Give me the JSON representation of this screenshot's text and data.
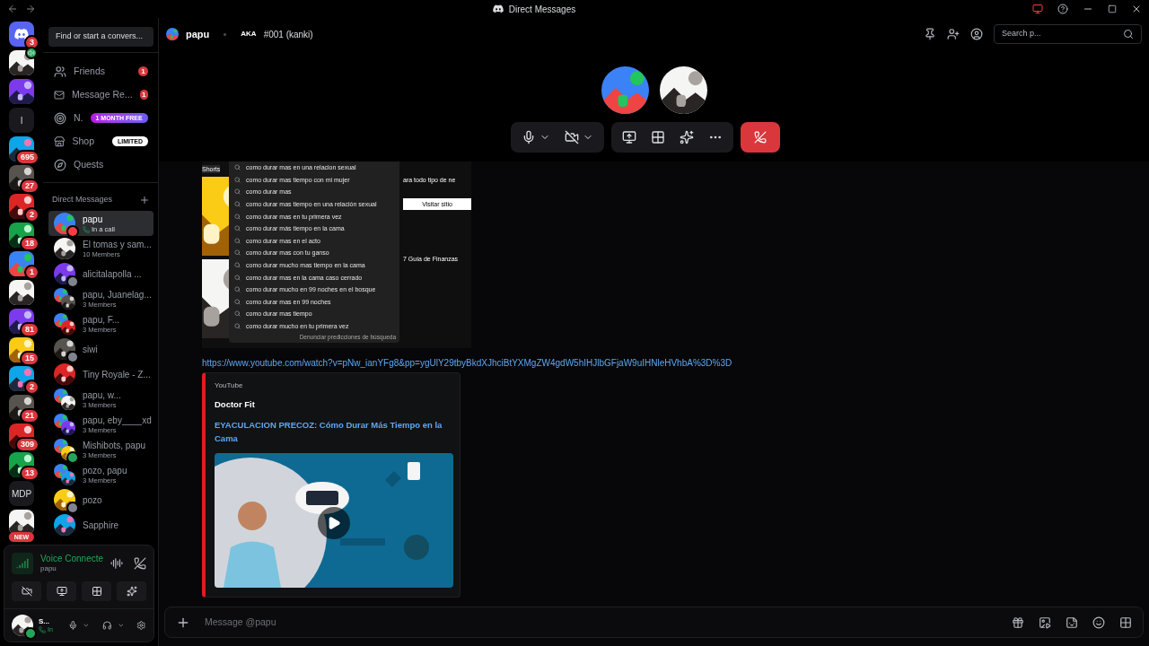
{
  "window": {
    "title": "Direct Messages"
  },
  "servers": [
    {
      "kind": "home",
      "badge": "3"
    },
    {
      "kind": "picture",
      "voice": true
    },
    {
      "kind": "picture"
    },
    {
      "kind": "text",
      "label": "l"
    },
    {
      "kind": "picture",
      "badge": "695"
    },
    {
      "kind": "picture",
      "badge": "27"
    },
    {
      "kind": "picture",
      "badge": "2"
    },
    {
      "kind": "picture",
      "badge": "18"
    },
    {
      "kind": "picture",
      "badge": "1"
    },
    {
      "kind": "picture"
    },
    {
      "kind": "picture",
      "badge": "81"
    },
    {
      "kind": "picture",
      "badge": "15"
    },
    {
      "kind": "picture",
      "badge": "2"
    },
    {
      "kind": "picture",
      "badge": "21"
    },
    {
      "kind": "picture",
      "badge": "309"
    },
    {
      "kind": "picture",
      "badge": "13"
    },
    {
      "kind": "text",
      "label": "MDP"
    },
    {
      "kind": "picture",
      "tag": "NEW"
    }
  ],
  "search": {
    "label": "Find or start a convers..."
  },
  "nav": [
    {
      "kind": "friends",
      "label": "Friends",
      "badge": "1"
    },
    {
      "kind": "requests",
      "label": "Message Re...",
      "badge": "1"
    },
    {
      "kind": "nitro",
      "label": "N.",
      "promo": "1 MONTH FREE"
    },
    {
      "kind": "shop",
      "label": "Shop",
      "tag": "LIMITED"
    },
    {
      "kind": "quests",
      "label": "Quests"
    }
  ],
  "dm_header": {
    "label": "Direct Messages"
  },
  "dms": [
    {
      "name": "papu",
      "subtitle": "In a call",
      "in_call": true,
      "group": false,
      "color": "#f23f43",
      "selected": true
    },
    {
      "name": "El tomas y sam...",
      "subtitle": "10 Members",
      "group": false,
      "selected": false
    },
    {
      "name": "alicitalapolla ...",
      "group": false,
      "color": "#80848e",
      "selected": false
    },
    {
      "name": "papu, Juanelag...",
      "subtitle": "3 Members",
      "group": true,
      "selected": false
    },
    {
      "name": "papu, F...",
      "subtitle": "3 Members",
      "group": true,
      "selected": false
    },
    {
      "name": "siwi",
      "group": false,
      "color": "#80848e",
      "selected": false
    },
    {
      "name": "Tiny Royale - Z...",
      "group": false,
      "selected": false
    },
    {
      "name": "papu, w...",
      "subtitle": "3 Members",
      "group": true,
      "selected": false
    },
    {
      "name": "papu, eby____xd",
      "subtitle": "3 Members",
      "group": true,
      "selected": false
    },
    {
      "name": "Mishibots, papu",
      "subtitle": "3 Members",
      "group": true,
      "color": "#23a55a",
      "selected": false
    },
    {
      "name": "pozo, papu",
      "subtitle": "3 Members",
      "group": true,
      "selected": false
    },
    {
      "name": "pozo",
      "group": false,
      "color": "#80848e",
      "selected": false
    },
    {
      "name": "Sapphire",
      "group": false,
      "selected": false
    }
  ],
  "voice": {
    "status": "Voice Connecte",
    "channel": "papu"
  },
  "user": {
    "name": "S...",
    "activity": "In",
    "color": "#23a55a"
  },
  "header": {
    "name": "papu",
    "aka": "AKA",
    "tag": "#001 (kanki)",
    "search_placeholder": "Search p..."
  },
  "message": {
    "screenshot": {
      "tab": "Shorts",
      "suggestions": [
        "como durar mas en una relacion sexual",
        "como durar mas tiempo con mi mujer",
        "como durar mas",
        "como durar mas tiempo en una relación sexual",
        "como durar mas en tu primera vez",
        "como durar más tiempo en la cama",
        "como durar mas en el acto",
        "como durar mas con tu ganso",
        "como durar mucho mas tiempo en la cama",
        "como durar mas en la cama caso cerrado",
        "como durar mucho en 99 noches en el bosque",
        "como durar mas en 99 noches",
        "como durar mas tiempo",
        "como durar mucho en tu primera vez"
      ],
      "report": "Denunciar predicciones de búsqueda",
      "side_text": "ara todo tipo de ne",
      "visit": "Visitar sitio",
      "side_title": "7 Guía de Finanzas"
    },
    "link": "https://www.youtube.com/watch?v=pNw_ianYFg8&pp=ygUlY29tbyBkdXJhciBtYXMgZW4gdW5hIHJlbGFjaW9uIHNleHVhbA%3D%3D",
    "embed": {
      "provider": "YouTube",
      "author": "Doctor Fit",
      "title": "EYACULACION PRECOZ: Cómo Durar Más Tiempo en la Cama"
    }
  },
  "composer": {
    "placeholder": "Message @papu"
  }
}
